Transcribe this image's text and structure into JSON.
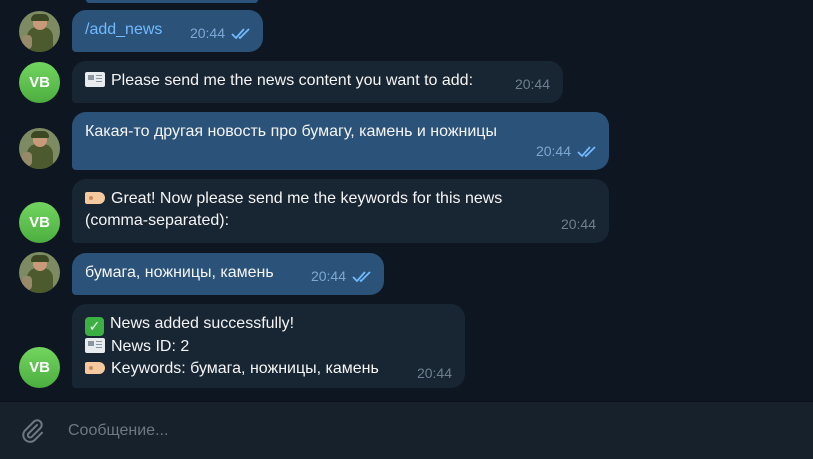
{
  "messages": [
    {
      "text": "/add_news",
      "time": "20:44",
      "direction": "out",
      "avatar": "photo"
    },
    {
      "text": "Please send me the news content you want to add:",
      "time": "20:44",
      "direction": "in",
      "avatar": "VB",
      "emoji": "newspaper"
    },
    {
      "text": "Какая-то другая новость про бумагу, камень и ножницы",
      "time": "20:44",
      "direction": "out",
      "avatar": "photo"
    },
    {
      "text": "Great! Now please send me the keywords for this news\n(comma-separated):",
      "time": "20:44",
      "direction": "in",
      "avatar": "VB",
      "emoji": "label"
    },
    {
      "text": "бумага, ножницы, камень",
      "time": "20:44",
      "direction": "out",
      "avatar": "photo"
    },
    {
      "lines": [
        "News added successfully!",
        "News ID: 2",
        "Keywords: бумага, ножницы, камень"
      ],
      "time": "20:44",
      "direction": "in",
      "avatar": "VB",
      "emojis": [
        "check-mark",
        "newspaper",
        "label"
      ]
    }
  ],
  "avatar_initials": "VB",
  "input": {
    "placeholder": "Сообщение..."
  },
  "colors": {
    "background": "#0e1621",
    "outgoing_bubble": "#2b5278",
    "incoming_bubble": "#182533",
    "avatar_green": "#5fc24f",
    "read_checks": "#71baff",
    "input_bar": "#17212b"
  },
  "icons": {
    "attach": "paperclip-icon",
    "read_status": "double-check-icon"
  }
}
